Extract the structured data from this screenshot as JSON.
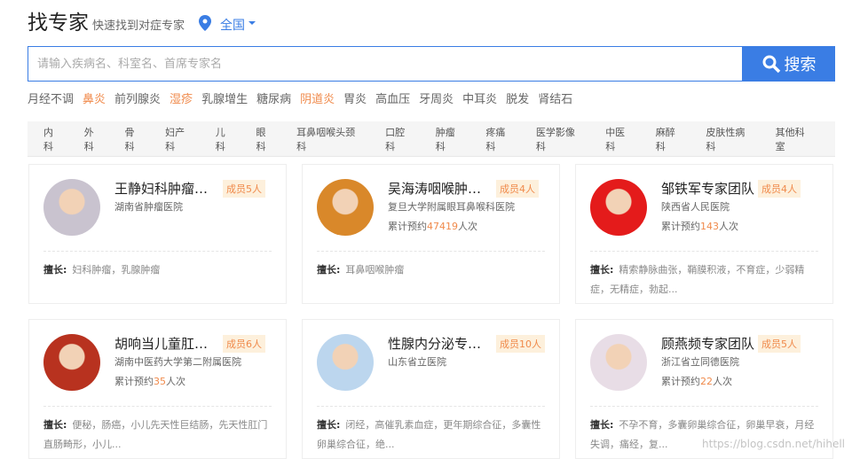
{
  "header": {
    "title": "找专家",
    "subtitle": "快速找到对症专家",
    "region": "全国"
  },
  "search": {
    "placeholder": "请输入疾病名、科室名、首席专家名",
    "button": "搜索"
  },
  "hot_tags": [
    {
      "label": "月经不调",
      "hl": false
    },
    {
      "label": "鼻炎",
      "hl": true
    },
    {
      "label": "前列腺炎",
      "hl": false
    },
    {
      "label": "湿疹",
      "hl": true
    },
    {
      "label": "乳腺增生",
      "hl": false
    },
    {
      "label": "糖尿病",
      "hl": false
    },
    {
      "label": "阴道炎",
      "hl": true
    },
    {
      "label": "胃炎",
      "hl": false
    },
    {
      "label": "高血压",
      "hl": false
    },
    {
      "label": "牙周炎",
      "hl": false
    },
    {
      "label": "中耳炎",
      "hl": false
    },
    {
      "label": "脱发",
      "hl": false
    },
    {
      "label": "肾结石",
      "hl": false
    }
  ],
  "departments": [
    "内科",
    "外科",
    "骨科",
    "妇产科",
    "儿科",
    "眼科",
    "耳鼻咽喉头颈科",
    "口腔科",
    "肿瘤科",
    "疼痛科",
    "医学影像科",
    "中医科",
    "麻醉科",
    "皮肤性病科",
    "其他科室"
  ],
  "labels": {
    "skill": "擅长:",
    "book_prefix": "累计预约",
    "book_suffix": "人次"
  },
  "cards": [
    {
      "name": "王静妇科肿瘤专家团队",
      "badge": "成员5人",
      "hospital": "湖南省肿瘤医院",
      "bookings": null,
      "skill": "妇科肿瘤，乳腺肿瘤",
      "avatar_color": "#c9c3cf"
    },
    {
      "name": "吴海涛咽喉肿瘤专家团队",
      "badge": "成员4人",
      "hospital": "复旦大学附属眼耳鼻喉科医院",
      "bookings": "47419",
      "skill": "耳鼻咽喉肿瘤",
      "avatar_color": "#d9882a"
    },
    {
      "name": "邹铁军专家团队",
      "badge": "成员4人",
      "hospital": "陕西省人民医院",
      "bookings": "143",
      "skill": "精索静脉曲张，鞘膜积液，不育症，少弱精症，无精症，勃起...",
      "avatar_color": "#e41b1b"
    },
    {
      "name": "胡响当儿童肛肠专家团队",
      "badge": "成员6人",
      "hospital": "湖南中医药大学第二附属医院",
      "bookings": "35",
      "skill": "便秘，肠癌，小儿先天性巨结肠，先天性肛门直肠畸形，小儿...",
      "avatar_color": "#b8321f"
    },
    {
      "name": "性腺内分泌专家团队",
      "badge": "成员10人",
      "hospital": "山东省立医院",
      "bookings": null,
      "skill": "闭经，高催乳素血症，更年期综合征，多囊性卵巢综合征，绝...",
      "avatar_color": "#bcd6ee"
    },
    {
      "name": "顾燕频专家团队",
      "badge": "成员5人",
      "hospital": "浙江省立同德医院",
      "bookings": "22",
      "skill": "不孕不育，多囊卵巢综合征，卵巢早衰，月经失调，痛经，复...",
      "avatar_color": "#e8dde6"
    }
  ],
  "watermark": "https://blog.csdn.net/hihell",
  "colors": {
    "accent": "#3a7de4",
    "highlight": "#f08a4b"
  }
}
